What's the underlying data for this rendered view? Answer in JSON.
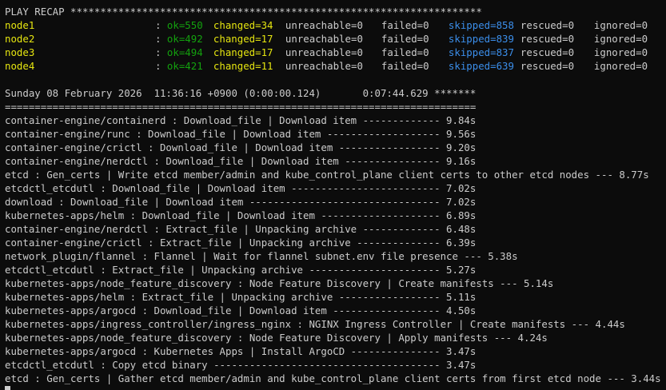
{
  "recap_header": "PLAY RECAP *********************************************************************",
  "colon": ": ",
  "hosts": [
    {
      "name": "node1",
      "ok": "ok=550",
      "changed": "changed=34",
      "unreachable": "unreachable=0",
      "failed": "failed=0",
      "skipped": "skipped=858",
      "rescued": "rescued=0",
      "ignored": "ignored=0"
    },
    {
      "name": "node2",
      "ok": "ok=492",
      "changed": "changed=17",
      "unreachable": "unreachable=0",
      "failed": "failed=0",
      "skipped": "skipped=839",
      "rescued": "rescued=0",
      "ignored": "ignored=0"
    },
    {
      "name": "node3",
      "ok": "ok=494",
      "changed": "changed=17",
      "unreachable": "unreachable=0",
      "failed": "failed=0",
      "skipped": "skipped=837",
      "rescued": "rescued=0",
      "ignored": "ignored=0"
    },
    {
      "name": "node4",
      "ok": "ok=421",
      "changed": "changed=11",
      "unreachable": "unreachable=0",
      "failed": "failed=0",
      "skipped": "skipped=639",
      "rescued": "rescued=0",
      "ignored": "ignored=0"
    }
  ],
  "timestamp_line": "Sunday 08 February 2026  11:36:16 +0900 (0:00:00.124)       0:07:44.629 *******",
  "separator": "===============================================================================",
  "tasks": [
    "container-engine/containerd : Download_file | Download item ------------- 9.84s",
    "container-engine/runc : Download_file | Download item ------------------- 9.56s",
    "container-engine/crictl : Download_file | Download item ----------------- 9.20s",
    "container-engine/nerdctl : Download_file | Download item ---------------- 9.16s",
    "etcd : Gen_certs | Write etcd member/admin and kube_control_plane client certs to other etcd nodes --- 8.77s",
    "etcdctl_etcdutl : Download_file | Download item ------------------------- 7.02s",
    "download : Download_file | Download item -------------------------------- 7.02s",
    "kubernetes-apps/helm : Download_file | Download item -------------------- 6.89s",
    "container-engine/nerdctl : Extract_file | Unpacking archive ------------- 6.48s",
    "container-engine/crictl : Extract_file | Unpacking archive -------------- 6.39s",
    "network_plugin/flannel : Flannel | Wait for flannel subnet.env file presence --- 5.38s",
    "etcdctl_etcdutl : Extract_file | Unpacking archive ---------------------- 5.27s",
    "kubernetes-apps/node_feature_discovery : Node Feature Discovery | Create manifests --- 5.14s",
    "kubernetes-apps/helm : Extract_file | Unpacking archive ----------------- 5.11s",
    "kubernetes-apps/argocd : Download_file | Download item ------------------ 4.50s",
    "kubernetes-apps/ingress_controller/ingress_nginx : NGINX Ingress Controller | Create manifests --- 4.44s",
    "kubernetes-apps/node_feature_discovery : Node Feature Discovery | Apply manifests --- 4.24s",
    "kubernetes-apps/argocd : Kubernetes Apps | Install ArgoCD --------------- 3.47s",
    "etcdctl_etcdutl : Copy etcd binary -------------------------------------- 3.47s",
    "etcd : Gen_certs | Gather etcd member/admin and kube_control_plane client certs from first etcd node --- 3.44s"
  ],
  "colors": {
    "background": "#0c0c0c",
    "text": "#cccccc",
    "changed": "#e5e510",
    "ok": "#13a10e",
    "skipped": "#3b8eea"
  }
}
